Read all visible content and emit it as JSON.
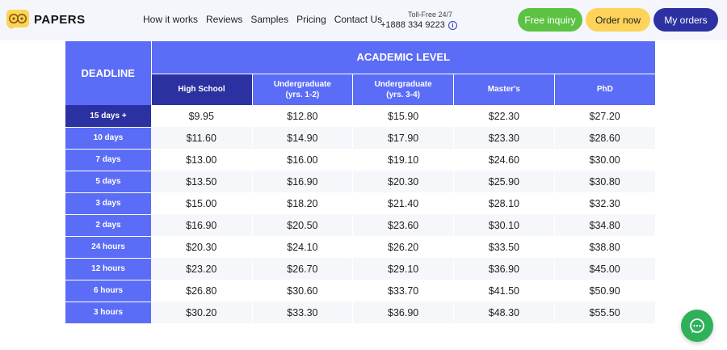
{
  "header": {
    "logo_text": "PAPERS",
    "nav": [
      "How it works",
      "Reviews",
      "Samples",
      "Pricing",
      "Contact Us"
    ],
    "phone_label": "Toll-Free 24/7",
    "phone_number": "+1888 334 9223",
    "buttons": {
      "free_inquiry": "Free inquiry",
      "order_now": "Order now",
      "my_orders": "My orders"
    }
  },
  "table": {
    "deadline_header": "DEADLINE",
    "academic_header": "ACADEMIC LEVEL",
    "levels": [
      {
        "line1": "High School",
        "line2": ""
      },
      {
        "line1": "Undergraduate",
        "line2": "(yrs. 1-2)"
      },
      {
        "line1": "Undergraduate",
        "line2": "(yrs. 3-4)"
      },
      {
        "line1": "Master's",
        "line2": ""
      },
      {
        "line1": "PhD",
        "line2": ""
      }
    ],
    "selected_level": 0,
    "selected_row": 0,
    "rows": [
      {
        "deadline": "15 days +",
        "prices": [
          "$9.95",
          "$12.80",
          "$15.90",
          "$22.30",
          "$27.20"
        ]
      },
      {
        "deadline": "10 days",
        "prices": [
          "$11.60",
          "$14.90",
          "$17.90",
          "$23.30",
          "$28.60"
        ]
      },
      {
        "deadline": "7 days",
        "prices": [
          "$13.00",
          "$16.00",
          "$19.10",
          "$24.60",
          "$30.00"
        ]
      },
      {
        "deadline": "5 days",
        "prices": [
          "$13.50",
          "$16.90",
          "$20.30",
          "$25.90",
          "$30.80"
        ]
      },
      {
        "deadline": "3 days",
        "prices": [
          "$15.00",
          "$18.20",
          "$21.40",
          "$28.10",
          "$32.30"
        ]
      },
      {
        "deadline": "2 days",
        "prices": [
          "$16.90",
          "$20.50",
          "$23.60",
          "$30.10",
          "$34.80"
        ]
      },
      {
        "deadline": "24 hours",
        "prices": [
          "$20.30",
          "$24.10",
          "$26.20",
          "$33.50",
          "$38.80"
        ]
      },
      {
        "deadline": "12 hours",
        "prices": [
          "$23.20",
          "$26.70",
          "$29.10",
          "$36.90",
          "$45.00"
        ]
      },
      {
        "deadline": "6 hours",
        "prices": [
          "$26.80",
          "$30.60",
          "$33.70",
          "$41.50",
          "$50.90"
        ]
      },
      {
        "deadline": "3 hours",
        "prices": [
          "$30.20",
          "$33.30",
          "$36.90",
          "$48.30",
          "$55.50"
        ]
      }
    ]
  },
  "colors": {
    "header_bg": "#f5f6fb",
    "table_blue": "#5b6df6",
    "table_dark": "#2b31a0",
    "free_inquiry": "#5cc243",
    "order_now": "#fdd35a",
    "chat_green": "#2eb159"
  },
  "icons": {
    "logo": "papers-logo-icon",
    "info": "info-icon",
    "chat": "chat-icon"
  }
}
